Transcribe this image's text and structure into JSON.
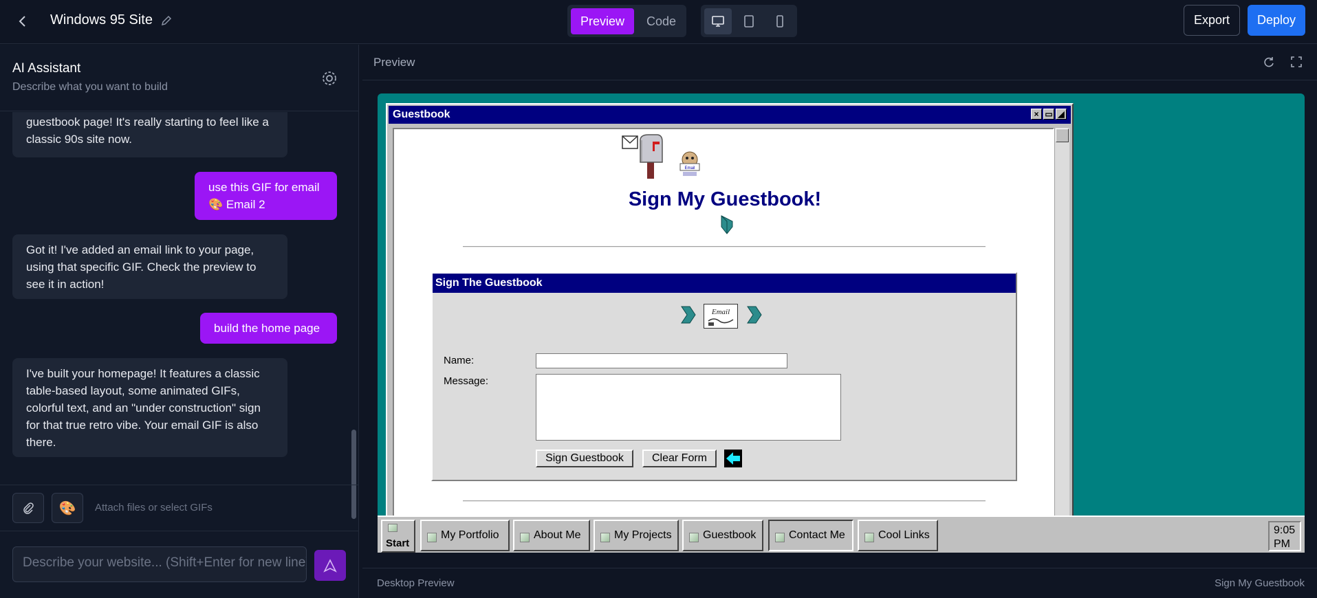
{
  "header": {
    "site_title": "Windows 95 Site",
    "preview_label": "Preview",
    "code_label": "Code",
    "export_label": "Export",
    "deploy_label": "Deploy"
  },
  "assistant": {
    "title": "AI Assistant",
    "subtitle": "Describe what you want to build",
    "messages": [
      {
        "role": "ai",
        "text": "guestbook page! It's really starting to feel like a classic 90s site now."
      },
      {
        "role": "user",
        "text": "use this GIF for email 🎨 Email 2"
      },
      {
        "role": "ai",
        "text": "Got it! I've added an email link to your page, using that specific GIF. Check the preview to see it in action!"
      },
      {
        "role": "user",
        "text": "build the home page"
      },
      {
        "role": "ai",
        "text": "I've built your homepage! It features a classic table-based layout, some animated GIFs, colorful text, and an \"under construction\" sign for that true retro vibe. Your email GIF is also there."
      }
    ],
    "attach_hint": "Attach files or select GIFs",
    "input_placeholder": "Describe your website... (Shift+Enter for new line)"
  },
  "preview": {
    "label": "Preview",
    "footer_left": "Desktop Preview",
    "footer_right": "Sign My Guestbook"
  },
  "window": {
    "title": "Guestbook",
    "heading": "Sign My Guestbook!",
    "form": {
      "title": "Sign The Guestbook",
      "name_label": "Name:",
      "message_label": "Message:",
      "name_value": "",
      "message_value": "",
      "submit_label": "Sign Guestbook",
      "clear_label": "Clear Form",
      "email_gif_text": "Email"
    }
  },
  "taskbar": {
    "start_label": "Start",
    "items": [
      {
        "label": "My Portfolio"
      },
      {
        "label": "About Me"
      },
      {
        "label": "My Projects"
      },
      {
        "label": "Guestbook"
      },
      {
        "label": "Contact Me"
      },
      {
        "label": "Cool Links"
      }
    ],
    "clock": "9:05 PM"
  },
  "colors": {
    "accent_purple": "#9b16f5",
    "deploy_blue": "#1e6ff2",
    "desktop_teal": "#008080",
    "title_navy": "#000080"
  }
}
